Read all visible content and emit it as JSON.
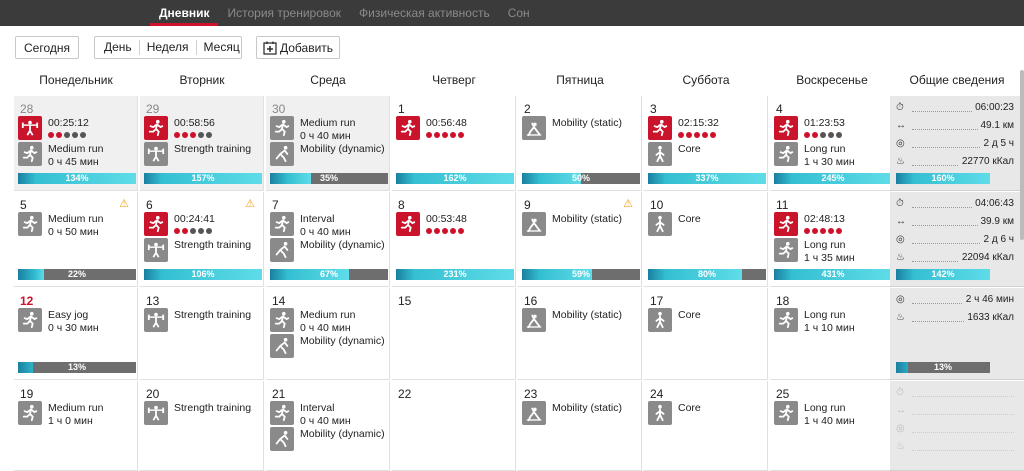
{
  "nav": {
    "tabs": [
      "Дневник",
      "История тренировок",
      "Физическая активность",
      "Сон"
    ],
    "active": 0
  },
  "toolbar": {
    "today": "Сегодня",
    "day": "День",
    "week": "Неделя",
    "month": "Месяц",
    "add": "Добавить"
  },
  "days": [
    "Понедельник",
    "Вторник",
    "Среда",
    "Четверг",
    "Пятница",
    "Суббота",
    "Воскресенье",
    "Общие сведения"
  ],
  "colors": {
    "accent": "#d0112b",
    "progress": "#34bfd2",
    "icon_gray": "#8a8a8a"
  },
  "weeks": [
    {
      "cells": [
        {
          "num": "28",
          "past": true,
          "acts": [
            {
              "icon": "strength-icon",
              "red": true,
              "text": "00:25:12",
              "dots": [
                1,
                1,
                0,
                0,
                0
              ]
            },
            {
              "icon": "running-icon",
              "text": "Medium run",
              "sub": "0 ч 45 мин"
            }
          ],
          "pct": 134,
          "pct_label": "134%"
        },
        {
          "num": "29",
          "past": true,
          "acts": [
            {
              "icon": "running-icon",
              "red": true,
              "text": "00:58:56",
              "dots": [
                1,
                1,
                1,
                0,
                0
              ]
            },
            {
              "icon": "strength-icon",
              "text": "Strength training"
            }
          ],
          "pct": 157,
          "pct_label": "157%"
        },
        {
          "num": "30",
          "past": true,
          "acts": [
            {
              "icon": "running-icon",
              "text": "Medium run",
              "sub": "0 ч 40 мин"
            },
            {
              "icon": "stretch-icon",
              "text": "Mobility (dynamic)"
            }
          ],
          "pct": 35,
          "pct_label": "35%"
        },
        {
          "num": "1",
          "acts": [
            {
              "icon": "running-icon",
              "red": true,
              "text": "00:56:48",
              "dots": [
                1,
                1,
                1,
                1,
                1
              ]
            }
          ],
          "pct": 162,
          "pct_label": "162%"
        },
        {
          "num": "2",
          "acts": [
            {
              "icon": "mobility-icon",
              "text": "Mobility (static)"
            }
          ],
          "pct": 50,
          "pct_label": "50%"
        },
        {
          "num": "3",
          "acts": [
            {
              "icon": "running-icon",
              "red": true,
              "text": "02:15:32",
              "dots": [
                1,
                1,
                1,
                1,
                1
              ]
            },
            {
              "icon": "core-icon",
              "text": "Core"
            }
          ],
          "pct": 337,
          "pct_label": "337%"
        },
        {
          "num": "4",
          "acts": [
            {
              "icon": "running-icon",
              "red": true,
              "text": "01:23:53",
              "dots": [
                1,
                1,
                0,
                0,
                0
              ]
            },
            {
              "icon": "running-icon",
              "text": "Long run",
              "sub": "1 ч 30 мин"
            }
          ],
          "pct": 245,
          "pct_label": "245%"
        }
      ],
      "summary": {
        "time": "06:00:23",
        "distance": "49.1 км",
        "recovery": "2 д 5 ч",
        "calories": "22770 кКал",
        "pct": 160,
        "pct_label": "160%"
      }
    },
    {
      "cells": [
        {
          "num": "5",
          "warn": true,
          "acts": [
            {
              "icon": "running-icon",
              "text": "Medium run",
              "sub": "0 ч 50 мин"
            }
          ],
          "pct": 22,
          "pct_label": "22%"
        },
        {
          "num": "6",
          "warn": true,
          "acts": [
            {
              "icon": "running-icon",
              "red": true,
              "text": "00:24:41",
              "dots": [
                1,
                1,
                0,
                0,
                0
              ]
            },
            {
              "icon": "strength-icon",
              "text": "Strength training"
            }
          ],
          "pct": 106,
          "pct_label": "106%"
        },
        {
          "num": "7",
          "acts": [
            {
              "icon": "running-icon",
              "text": "Interval",
              "sub": "0 ч 40 мин"
            },
            {
              "icon": "stretch-icon",
              "text": "Mobility (dynamic)"
            }
          ],
          "pct": 67,
          "pct_label": "67%"
        },
        {
          "num": "8",
          "acts": [
            {
              "icon": "running-icon",
              "red": true,
              "text": "00:53:48",
              "dots": [
                1,
                1,
                1,
                1,
                1
              ]
            }
          ],
          "pct": 231,
          "pct_label": "231%"
        },
        {
          "num": "9",
          "warn": true,
          "acts": [
            {
              "icon": "mobility-icon",
              "text": "Mobility (static)"
            }
          ],
          "pct": 59,
          "pct_label": "59%"
        },
        {
          "num": "10",
          "acts": [
            {
              "icon": "core-icon",
              "text": "Core"
            }
          ],
          "pct": 80,
          "pct_label": "80%"
        },
        {
          "num": "11",
          "acts": [
            {
              "icon": "running-icon",
              "red": true,
              "text": "02:48:13",
              "dots": [
                1,
                1,
                1,
                1,
                1
              ]
            },
            {
              "icon": "running-icon",
              "text": "Long run",
              "sub": "1 ч 35 мин"
            }
          ],
          "pct": 431,
          "pct_label": "431%"
        }
      ],
      "summary": {
        "time": "04:06:43",
        "distance": "39.9 км",
        "recovery": "2 д 6 ч",
        "calories": "22094 кКал",
        "pct": 142,
        "pct_label": "142%"
      }
    },
    {
      "cells": [
        {
          "num": "12",
          "today": true,
          "acts": [
            {
              "icon": "running-icon",
              "text": "Easy jog",
              "sub": "0 ч 30 мин"
            }
          ],
          "pct": 13,
          "pct_label": "13%"
        },
        {
          "num": "13",
          "acts": [
            {
              "icon": "strength-icon",
              "text": "Strength training"
            }
          ]
        },
        {
          "num": "14",
          "acts": [
            {
              "icon": "running-icon",
              "text": "Medium run",
              "sub": "0 ч 40 мин"
            },
            {
              "icon": "stretch-icon",
              "text": "Mobility (dynamic)"
            }
          ]
        },
        {
          "num": "15",
          "acts": []
        },
        {
          "num": "16",
          "acts": [
            {
              "icon": "mobility-icon",
              "text": "Mobility (static)"
            }
          ]
        },
        {
          "num": "17",
          "acts": [
            {
              "icon": "core-icon",
              "text": "Core"
            }
          ]
        },
        {
          "num": "18",
          "acts": [
            {
              "icon": "running-icon",
              "text": "Long run",
              "sub": "1 ч 10 мин"
            }
          ]
        }
      ],
      "summary": {
        "recovery": "2 ч 46 мин",
        "calories": "1633 кКал",
        "pct": 13,
        "pct_label": "13%"
      }
    },
    {
      "cells": [
        {
          "num": "19",
          "acts": [
            {
              "icon": "running-icon",
              "text": "Medium run",
              "sub": "1 ч 0 мин"
            }
          ]
        },
        {
          "num": "20",
          "acts": [
            {
              "icon": "strength-icon",
              "text": "Strength training"
            }
          ]
        },
        {
          "num": "21",
          "acts": [
            {
              "icon": "running-icon",
              "text": "Interval",
              "sub": "0 ч 40 мин"
            },
            {
              "icon": "stretch-icon",
              "text": "Mobility (dynamic)"
            }
          ]
        },
        {
          "num": "22",
          "acts": []
        },
        {
          "num": "23",
          "acts": [
            {
              "icon": "mobility-icon",
              "text": "Mobility (static)"
            }
          ]
        },
        {
          "num": "24",
          "acts": [
            {
              "icon": "core-icon",
              "text": "Core"
            }
          ]
        },
        {
          "num": "25",
          "acts": [
            {
              "icon": "running-icon",
              "text": "Long run",
              "sub": "1 ч 40 мин"
            }
          ]
        }
      ],
      "summary": {
        "empty": true
      }
    }
  ]
}
